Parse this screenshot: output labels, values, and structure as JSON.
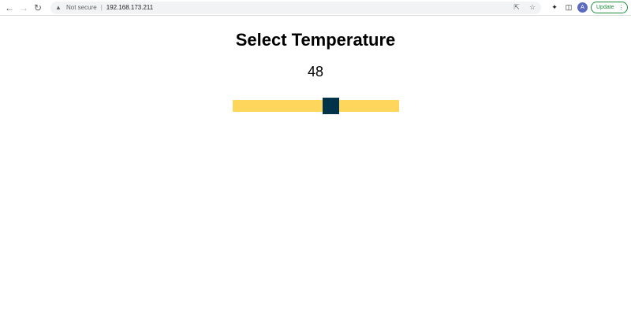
{
  "browser": {
    "security_label": "Not secure",
    "separator": "|",
    "url": "192.168.173.211",
    "profile_initial": "A",
    "update_label": "Update",
    "icons": {
      "back": "back-arrow-icon",
      "forward": "forward-arrow-icon",
      "reload": "reload-icon",
      "warning": "warning-icon",
      "share": "share-icon",
      "bookmark": "star-icon",
      "extensions": "puzzle-icon",
      "side_panel": "side-panel-icon",
      "menu": "kebab-menu-icon"
    },
    "colors": {
      "update_accent": "#1e8e3e",
      "avatar_bg": "#5c6bc0"
    }
  },
  "page": {
    "title": "Select Temperature",
    "temperature_value": "48",
    "slider": {
      "value": 48,
      "min": 0,
      "max": 100,
      "track_color": "#ffd65c",
      "thumb_color": "#003249"
    }
  }
}
